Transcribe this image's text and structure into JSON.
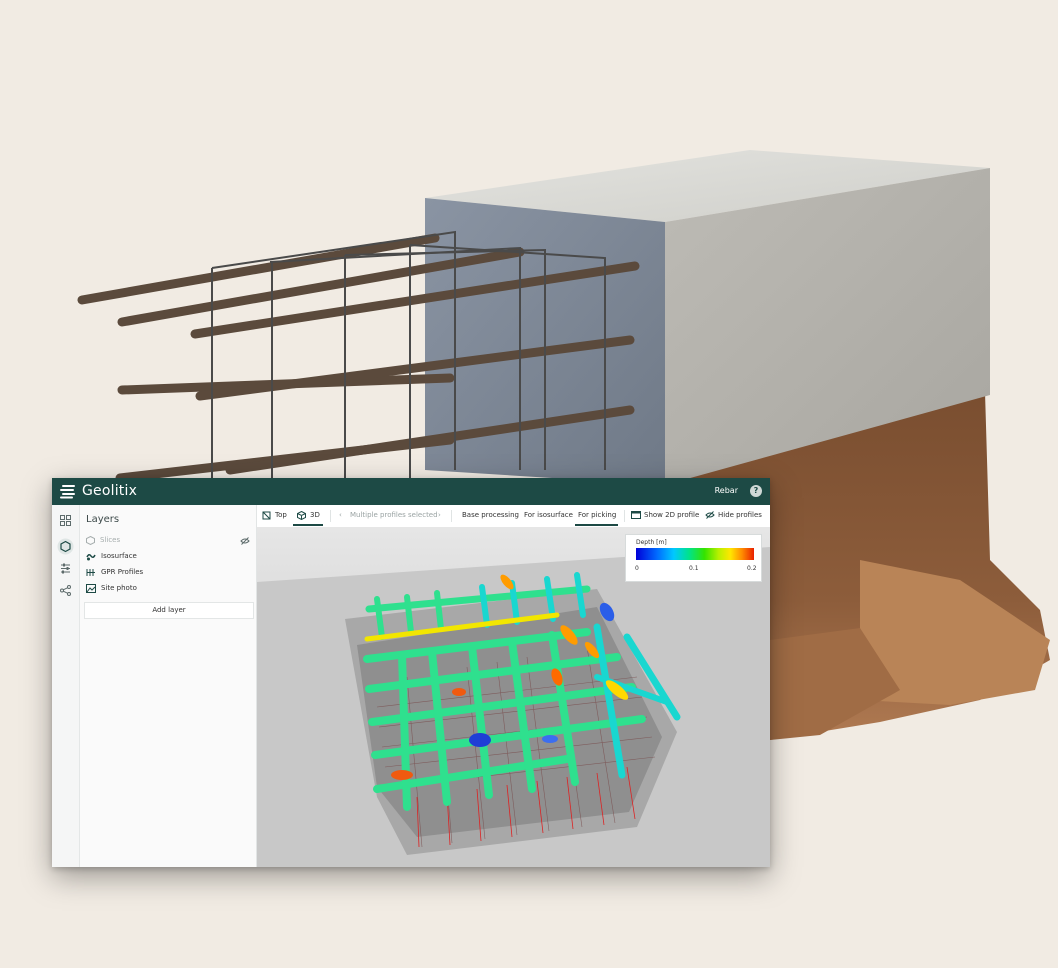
{
  "app": {
    "brand": "Geolitix",
    "project": "Rebar",
    "help_icon": "help-icon"
  },
  "layers_panel": {
    "title": "Layers",
    "items": [
      {
        "label": "Slices",
        "icon": "slices-icon",
        "hidden": true
      },
      {
        "label": "Isosurface",
        "icon": "isosurface-icon",
        "hidden": false
      },
      {
        "label": "GPR Profiles",
        "icon": "gpr-profiles-icon",
        "hidden": false
      },
      {
        "label": "Site photo",
        "icon": "site-photo-icon",
        "hidden": false
      }
    ],
    "add_button": "Add layer"
  },
  "toolbar": {
    "top_label": "Top",
    "view_3d_label": "3D",
    "profiles_nav": "Multiple profiles selected",
    "base_processing": "Base processing",
    "for_isosurface": "For isosurface",
    "for_picking": "For picking",
    "show_2d_profile": "Show 2D profile",
    "hide_profiles": "Hide profiles"
  },
  "legend": {
    "title": "Depth [m]",
    "ticks": [
      "0",
      "0.1",
      "0.2"
    ]
  },
  "colors": {
    "titlebar": "#1d4a45",
    "background": "#f1ebe3"
  }
}
